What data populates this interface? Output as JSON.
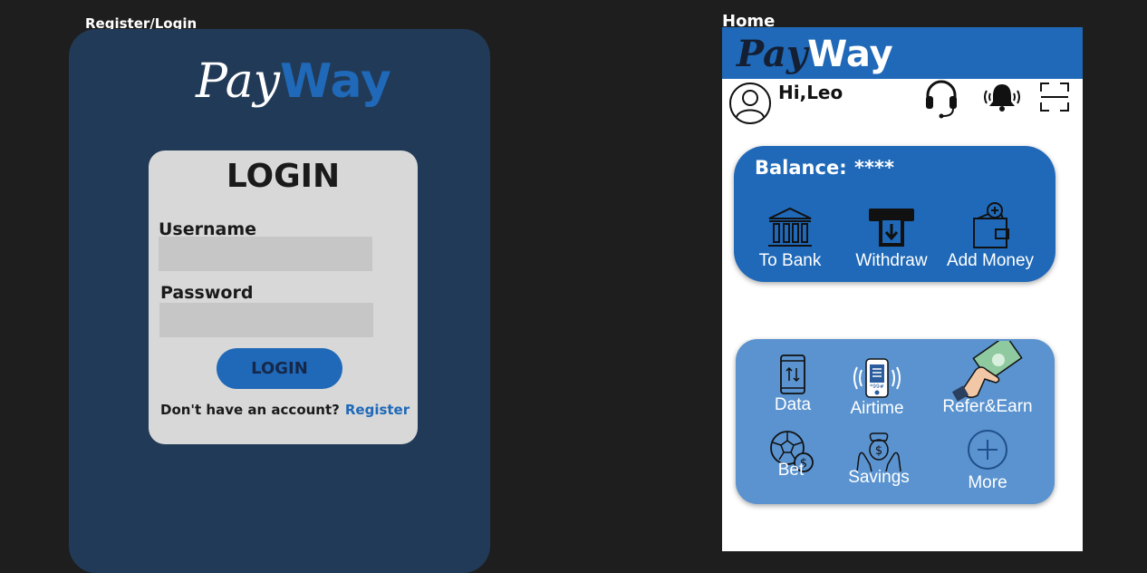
{
  "frames": {
    "login_label": "Register/Login",
    "home_label": "Home"
  },
  "brand": {
    "pay": "Pay",
    "way": "Way"
  },
  "login": {
    "title": "LOGIN",
    "username_label": "Username",
    "password_label": "Password",
    "username_value": "",
    "password_value": "",
    "button_label": "LOGIN",
    "no_account_text": "Don't have an account?",
    "register_link": "Register"
  },
  "home": {
    "greeting": "Hi,Leo",
    "balance_label": "Balance:",
    "balance_value": "****",
    "actions": [
      {
        "label": "To Bank",
        "icon": "bank-icon"
      },
      {
        "label": "Withdraw",
        "icon": "withdraw-icon"
      },
      {
        "label": "Add Money",
        "icon": "wallet-add-icon"
      }
    ],
    "services": [
      {
        "label": "Data",
        "icon": "data-transfer-icon"
      },
      {
        "label": "Airtime",
        "icon": "airtime-phone-icon"
      },
      {
        "label": "Refer&Earn",
        "icon": "refer-earn-icon"
      },
      {
        "label": "Bet",
        "icon": "bet-ball-icon"
      },
      {
        "label": "Savings",
        "icon": "savings-icon"
      },
      {
        "label": "More",
        "icon": "plus-circle-icon"
      }
    ],
    "header_icons": [
      "headset-icon",
      "bell-icon",
      "scan-icon"
    ]
  },
  "colors": {
    "background": "#1e1e1e",
    "login_panel": "#213a57",
    "brand_blue": "#1f69b8",
    "services_blue": "#5a93cf",
    "card_grey": "#d8d8d8"
  }
}
